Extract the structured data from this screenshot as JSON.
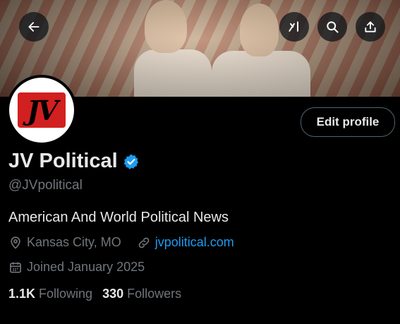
{
  "profile": {
    "display_name": "JV Political",
    "handle": "@JVpolitical",
    "bio": "American And World Political News",
    "location": "Kansas City, MO",
    "website": "jvpolitical.com",
    "joined": "Joined January 2025",
    "avatar_text": "JV",
    "verified": true
  },
  "stats": {
    "following_count": "1.1K",
    "following_label": "Following",
    "followers_count": "330",
    "followers_label": "Followers"
  },
  "actions": {
    "edit_profile_label": "Edit profile"
  },
  "icons": {
    "back": "arrow-left-icon",
    "grok": "grok-icon",
    "search": "search-icon",
    "share": "share-icon",
    "verified": "verified-badge-icon",
    "location": "location-pin-icon",
    "link": "link-icon",
    "calendar": "calendar-icon"
  },
  "colors": {
    "background": "#000000",
    "text_primary": "#e7e9ea",
    "text_secondary": "#71767b",
    "accent_blue": "#1d9bf0",
    "logo_red": "#d21f1f"
  }
}
